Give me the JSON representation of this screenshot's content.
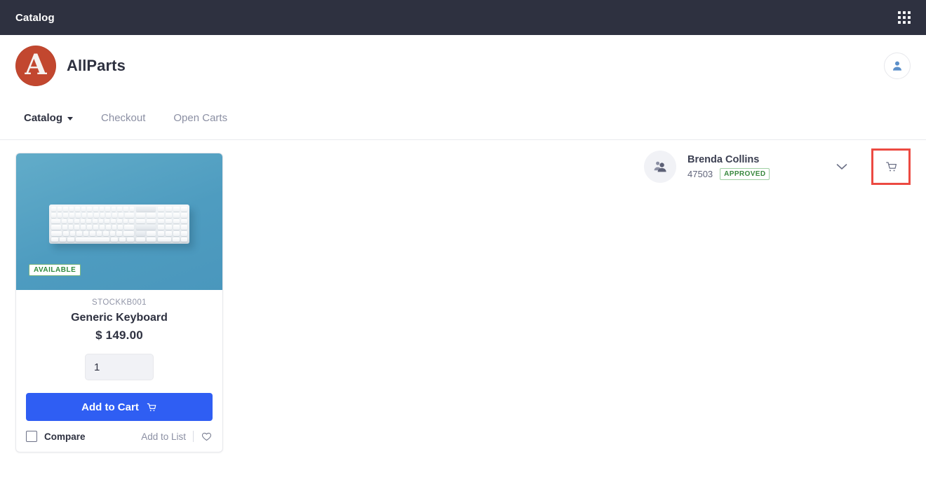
{
  "titlebar": {
    "title": "Catalog",
    "apps_icon": "grid-apps-icon"
  },
  "brand": {
    "logo_letter": "A",
    "name": "AllParts",
    "logo_color": "#c2472f",
    "account_icon": "user-avatar-icon"
  },
  "nav": {
    "items": [
      {
        "label": "Catalog",
        "active": true,
        "has_chevron": true
      },
      {
        "label": "Checkout",
        "active": false,
        "has_chevron": false
      },
      {
        "label": "Open Carts",
        "active": false,
        "has_chevron": false
      }
    ]
  },
  "user_row": {
    "avatar_icon": "group-people-icon",
    "name": "Brenda Collins",
    "id": "47503",
    "status_badge": "APPROVED",
    "status_color": "#39883f",
    "chevron_icon": "chevron-down-icon",
    "cart_icon": "shopping-cart-icon",
    "cart_highlight_color": "#ec4a42"
  },
  "product": {
    "image_alt": "white keyboard on blue background",
    "availability_badge": "AVAILABLE",
    "availability_color": "#2f8a3c",
    "sku": "STOCKKB001",
    "name": "Generic Keyboard",
    "price": "$ 149.00",
    "quantity_value": "1",
    "quantity_placeholder": "1",
    "add_to_cart_label": "Add to Cart",
    "add_to_cart_color": "#2f5ef3",
    "compare_label": "Compare",
    "add_to_list_label": "Add to List",
    "favorite_icon": "heart-icon"
  }
}
